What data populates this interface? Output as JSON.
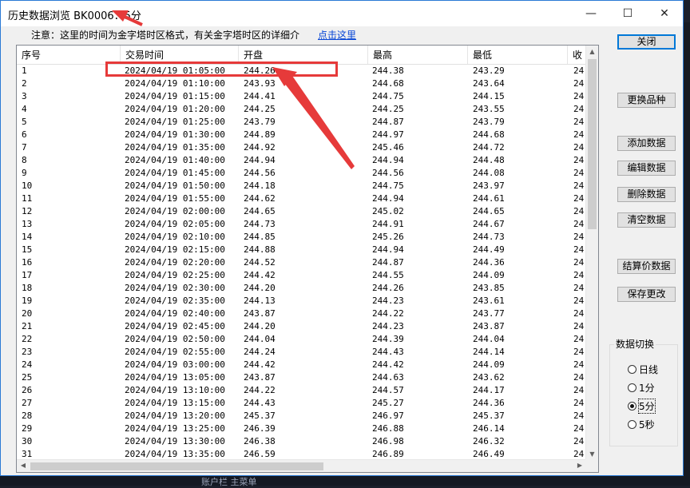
{
  "window": {
    "title": "历史数据浏览 BK0006：5分"
  },
  "caption": {
    "minimize": "—",
    "maximize": "☐",
    "close": "✕"
  },
  "note": {
    "text": "注意：这里的时间为金字塔时区格式，有关金字塔时区的详细介",
    "link": "点击这里"
  },
  "columns": [
    "序号",
    "交易时间",
    "开盘",
    "最高",
    "最低",
    "收"
  ],
  "rows": [
    [
      "1",
      "2024/04/19 01:05:00",
      "244.26",
      "244.38",
      "243.29",
      "24"
    ],
    [
      "2",
      "2024/04/19 01:10:00",
      "243.93",
      "244.68",
      "243.64",
      "24"
    ],
    [
      "3",
      "2024/04/19 01:15:00",
      "244.41",
      "244.75",
      "244.15",
      "24"
    ],
    [
      "4",
      "2024/04/19 01:20:00",
      "244.25",
      "244.25",
      "243.55",
      "24"
    ],
    [
      "5",
      "2024/04/19 01:25:00",
      "243.79",
      "244.87",
      "243.79",
      "24"
    ],
    [
      "6",
      "2024/04/19 01:30:00",
      "244.89",
      "244.97",
      "244.68",
      "24"
    ],
    [
      "7",
      "2024/04/19 01:35:00",
      "244.92",
      "245.46",
      "244.72",
      "24"
    ],
    [
      "8",
      "2024/04/19 01:40:00",
      "244.94",
      "244.94",
      "244.48",
      "24"
    ],
    [
      "9",
      "2024/04/19 01:45:00",
      "244.56",
      "244.56",
      "244.08",
      "24"
    ],
    [
      "10",
      "2024/04/19 01:50:00",
      "244.18",
      "244.75",
      "243.97",
      "24"
    ],
    [
      "11",
      "2024/04/19 01:55:00",
      "244.62",
      "244.94",
      "244.61",
      "24"
    ],
    [
      "12",
      "2024/04/19 02:00:00",
      "244.65",
      "245.02",
      "244.65",
      "24"
    ],
    [
      "13",
      "2024/04/19 02:05:00",
      "244.73",
      "244.91",
      "244.67",
      "24"
    ],
    [
      "14",
      "2024/04/19 02:10:00",
      "244.85",
      "245.26",
      "244.73",
      "24"
    ],
    [
      "15",
      "2024/04/19 02:15:00",
      "244.88",
      "244.94",
      "244.49",
      "24"
    ],
    [
      "16",
      "2024/04/19 02:20:00",
      "244.52",
      "244.87",
      "244.36",
      "24"
    ],
    [
      "17",
      "2024/04/19 02:25:00",
      "244.42",
      "244.55",
      "244.09",
      "24"
    ],
    [
      "18",
      "2024/04/19 02:30:00",
      "244.20",
      "244.26",
      "243.85",
      "24"
    ],
    [
      "19",
      "2024/04/19 02:35:00",
      "244.13",
      "244.23",
      "243.61",
      "24"
    ],
    [
      "20",
      "2024/04/19 02:40:00",
      "243.87",
      "244.22",
      "243.77",
      "24"
    ],
    [
      "21",
      "2024/04/19 02:45:00",
      "244.20",
      "244.23",
      "243.87",
      "24"
    ],
    [
      "22",
      "2024/04/19 02:50:00",
      "244.04",
      "244.39",
      "244.04",
      "24"
    ],
    [
      "23",
      "2024/04/19 02:55:00",
      "244.24",
      "244.43",
      "244.14",
      "24"
    ],
    [
      "24",
      "2024/04/19 03:00:00",
      "244.42",
      "244.42",
      "244.09",
      "24"
    ],
    [
      "25",
      "2024/04/19 13:05:00",
      "243.87",
      "244.63",
      "243.62",
      "24"
    ],
    [
      "26",
      "2024/04/19 13:10:00",
      "244.22",
      "244.57",
      "244.17",
      "24"
    ],
    [
      "27",
      "2024/04/19 13:15:00",
      "244.43",
      "245.27",
      "244.36",
      "24"
    ],
    [
      "28",
      "2024/04/19 13:20:00",
      "245.37",
      "246.97",
      "245.37",
      "24"
    ],
    [
      "29",
      "2024/04/19 13:25:00",
      "246.39",
      "246.88",
      "246.14",
      "24"
    ],
    [
      "30",
      "2024/04/19 13:30:00",
      "246.38",
      "246.98",
      "246.32",
      "24"
    ],
    [
      "31",
      "2024/04/19 13:35:00",
      "246.59",
      "246.89",
      "246.49",
      "24"
    ]
  ],
  "buttons": {
    "close": "关闭",
    "change_symbol": "更换品种",
    "add": "添加数据",
    "edit": "编辑数据",
    "delete": "删除数据",
    "clear": "清空数据",
    "settle": "结算价数据",
    "save": "保存更改"
  },
  "switch": {
    "title": "数据切换",
    "options": [
      "日线",
      "1分",
      "5分",
      "5秒"
    ],
    "selected": "5分"
  },
  "background": {
    "bottom_text": "账户栏    主菜单"
  },
  "colors": {
    "annotation": "#e63a3a",
    "link": "#0645d6",
    "focus": "#0078d7"
  }
}
